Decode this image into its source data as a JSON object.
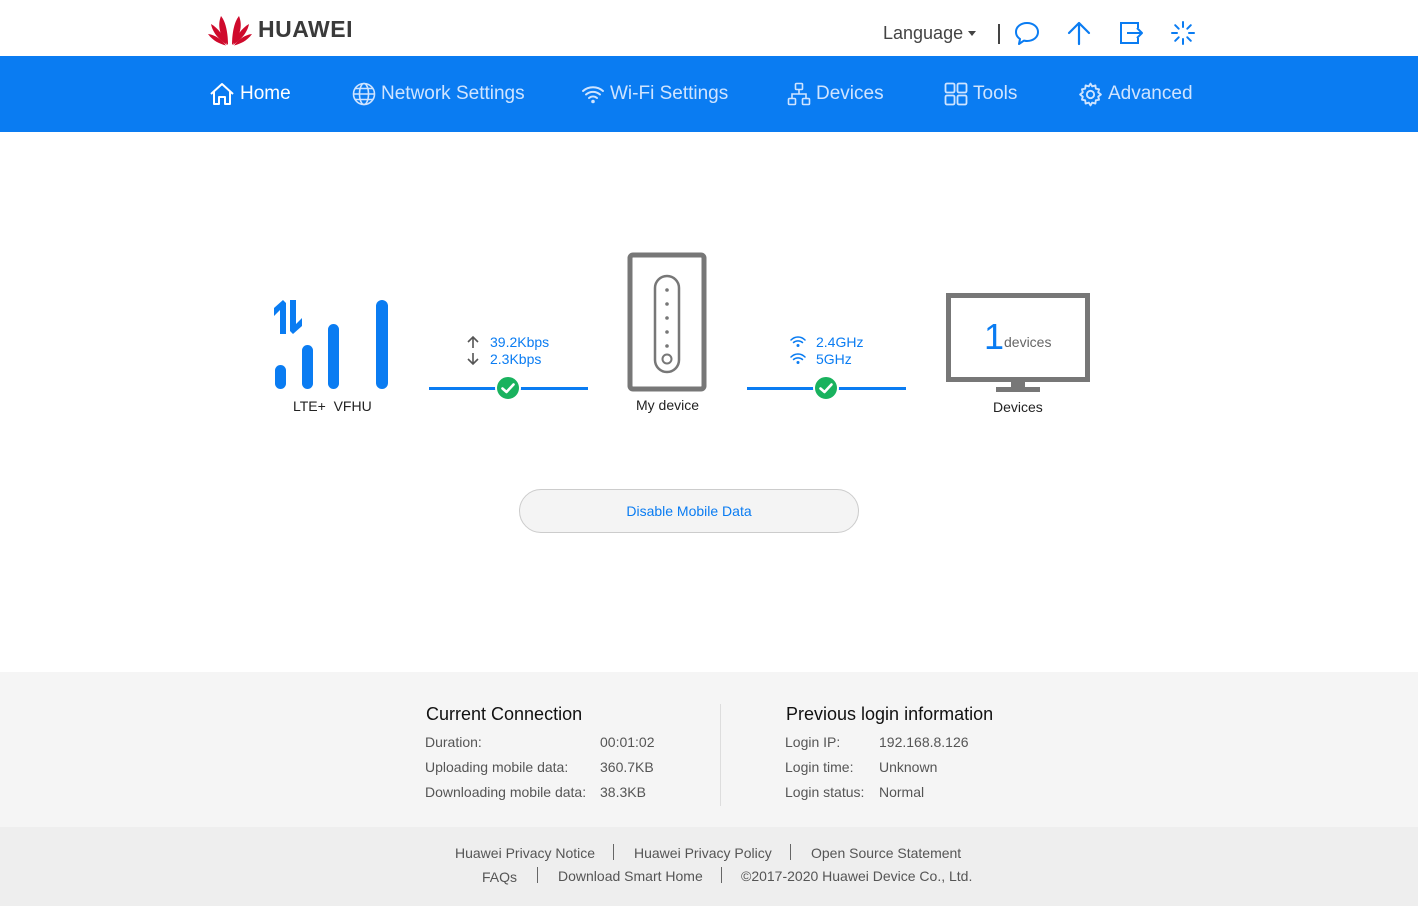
{
  "header": {
    "brand": "HUAWEI",
    "language_label": "Language",
    "icons": [
      "message-icon",
      "upload-arrow-icon",
      "logout-icon",
      "loading-spinner-icon"
    ]
  },
  "nav": {
    "items": [
      {
        "label": "Home",
        "icon": "home-icon",
        "active": true
      },
      {
        "label": "Network Settings",
        "icon": "globe-icon",
        "active": false
      },
      {
        "label": "Wi-Fi Settings",
        "icon": "wifi-icon",
        "active": false
      },
      {
        "label": "Devices",
        "icon": "devices-topology-icon",
        "active": false
      },
      {
        "label": "Tools",
        "icon": "tools-grid-icon",
        "active": false
      },
      {
        "label": "Advanced",
        "icon": "gear-icon",
        "active": false
      }
    ]
  },
  "diagram": {
    "signal": {
      "network_type": "LTE+",
      "operator": "VFHU"
    },
    "traffic": {
      "upload_rate": "39.2Kbps",
      "download_rate": "2.3Kbps"
    },
    "router_label": "My device",
    "wifi": {
      "band1": "2.4GHz",
      "band2": "5GHz"
    },
    "devices": {
      "count": "1",
      "unit": "devices",
      "label": "Devices"
    }
  },
  "actions": {
    "disable_mobile_data": "Disable Mobile Data"
  },
  "current_connection": {
    "title": "Current Connection",
    "rows": [
      {
        "key": "Duration:",
        "value": "00:01:02"
      },
      {
        "key": "Uploading mobile data:",
        "value": "360.7KB"
      },
      {
        "key": "Downloading mobile data:",
        "value": "38.3KB"
      }
    ]
  },
  "previous_login": {
    "title": "Previous login information",
    "rows": [
      {
        "key": "Login IP:",
        "value": "192.168.8.126"
      },
      {
        "key": "Login time:",
        "value": "Unknown"
      },
      {
        "key": "Login status:",
        "value": "Normal"
      }
    ]
  },
  "footer": {
    "links_row1": [
      "Huawei Privacy Notice",
      "Huawei Privacy Policy",
      "Open Source Statement"
    ],
    "links_row2": [
      "FAQs",
      "Download Smart Home"
    ],
    "copyright": "©2017-2020 Huawei Device Co., Ltd."
  },
  "colors": {
    "primary": "#0a7cf2",
    "success": "#19b25e",
    "brand_red": "#cf0a2c"
  }
}
